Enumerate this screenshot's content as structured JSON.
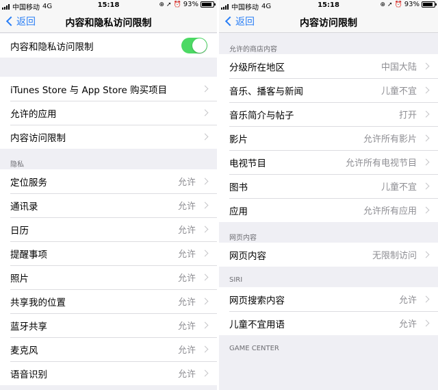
{
  "left": {
    "status": {
      "carrier": "中国移动",
      "network": "4G",
      "time": "15:18",
      "battery": "93%"
    },
    "nav": {
      "back": "返回",
      "title": "内容和隐私访问限制"
    },
    "toggle_row": {
      "label": "内容和隐私访问限制",
      "on": true
    },
    "menu": [
      {
        "label": "iTunes Store 与 App Store 购买项目"
      },
      {
        "label": "允许的应用"
      },
      {
        "label": "内容访问限制"
      }
    ],
    "privacy": {
      "header": "隐私",
      "items": [
        {
          "label": "定位服务",
          "value": "允许"
        },
        {
          "label": "通讯录",
          "value": "允许"
        },
        {
          "label": "日历",
          "value": "允许"
        },
        {
          "label": "提醒事项",
          "value": "允许"
        },
        {
          "label": "照片",
          "value": "允许"
        },
        {
          "label": "共享我的位置",
          "value": "允许"
        },
        {
          "label": "蓝牙共享",
          "value": "允许"
        },
        {
          "label": "麦克风",
          "value": "允许"
        },
        {
          "label": "语音识别",
          "value": "允许"
        }
      ]
    }
  },
  "right": {
    "status": {
      "carrier": "中国移动",
      "network": "4G",
      "time": "15:18",
      "battery": "93%"
    },
    "nav": {
      "back": "返回",
      "title": "内容访问限制"
    },
    "store": {
      "header": "允许的商店内容",
      "items": [
        {
          "label": "分级所在地区",
          "value": "中国大陆"
        },
        {
          "label": "音乐、播客与新闻",
          "value": "儿童不宜"
        },
        {
          "label": "音乐简介与帖子",
          "value": "打开"
        },
        {
          "label": "影片",
          "value": "允许所有影片"
        },
        {
          "label": "电视节目",
          "value": "允许所有电视节目"
        },
        {
          "label": "图书",
          "value": "儿童不宜"
        },
        {
          "label": "应用",
          "value": "允许所有应用"
        }
      ]
    },
    "web": {
      "header": "网页内容",
      "items": [
        {
          "label": "网页内容",
          "value": "无限制访问"
        }
      ]
    },
    "siri": {
      "header": "SIRI",
      "items": [
        {
          "label": "网页搜索内容",
          "value": "允许"
        },
        {
          "label": "儿童不宜用语",
          "value": "允许"
        }
      ]
    },
    "game_center": {
      "header": "GAME CENTER"
    }
  }
}
